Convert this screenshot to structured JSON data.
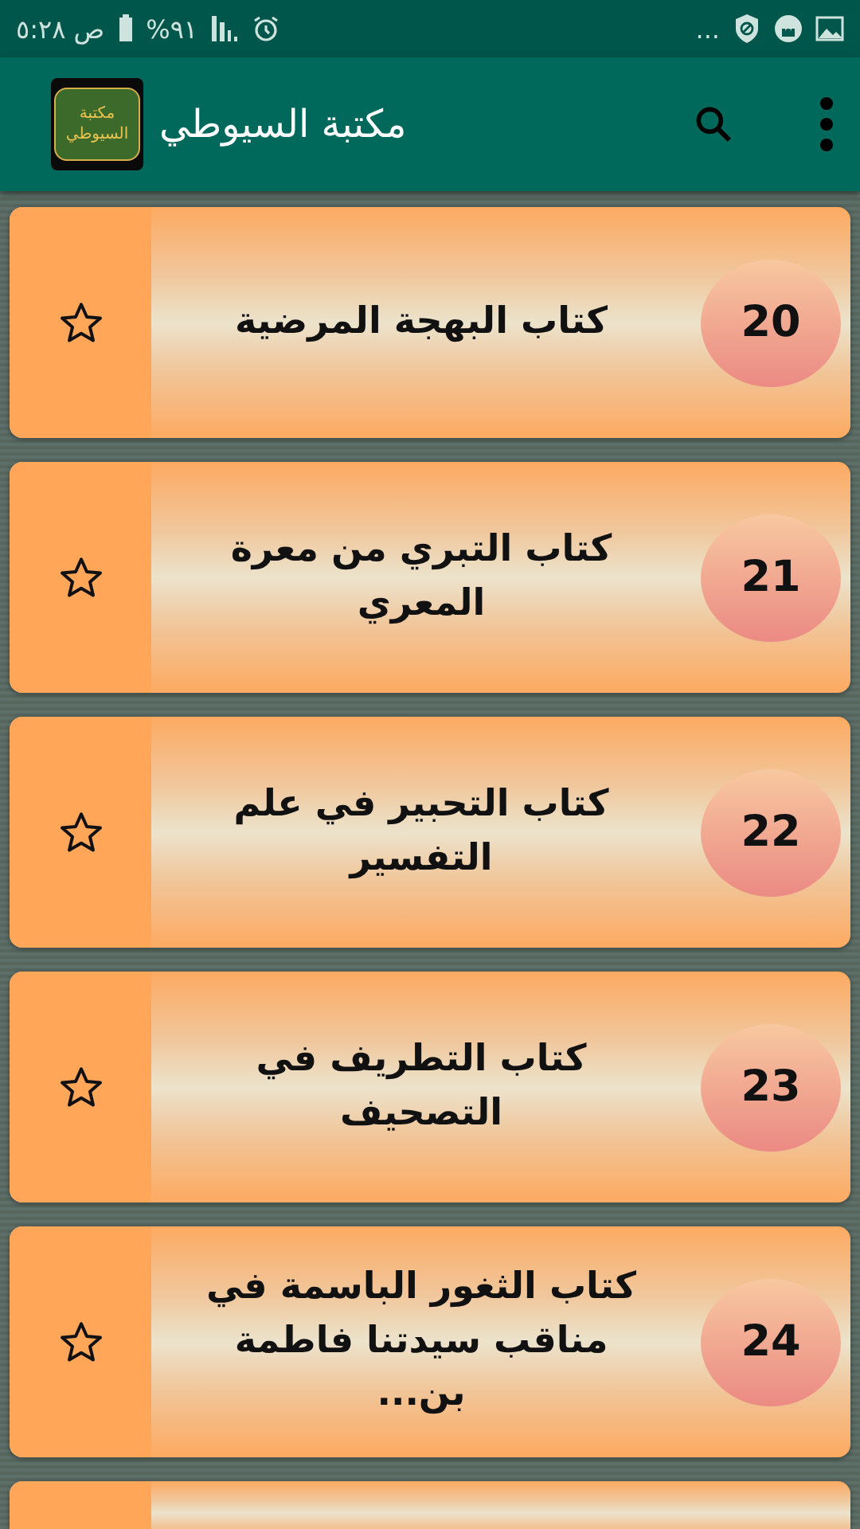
{
  "status_bar": {
    "time": "ص ٥:٢٨",
    "battery": "%٩١",
    "more": "..."
  },
  "app_bar": {
    "title": "مكتبة السيوطي",
    "logo_lines": [
      "مكتبة",
      "السيوطي"
    ]
  },
  "books": [
    {
      "number": "20",
      "title": "كتاب البهجة المرضية",
      "favorite": false
    },
    {
      "number": "21",
      "title": "كتاب التبري من معرة المعري",
      "favorite": false
    },
    {
      "number": "22",
      "title": "كتاب التحبير في علم التفسير",
      "favorite": false
    },
    {
      "number": "23",
      "title": "كتاب التطريف في التصحيف",
      "favorite": false
    },
    {
      "number": "24",
      "title": "كتاب الثغور الباسمة في مناقب سيدتنا فاطمة بن...",
      "favorite": false
    }
  ]
}
